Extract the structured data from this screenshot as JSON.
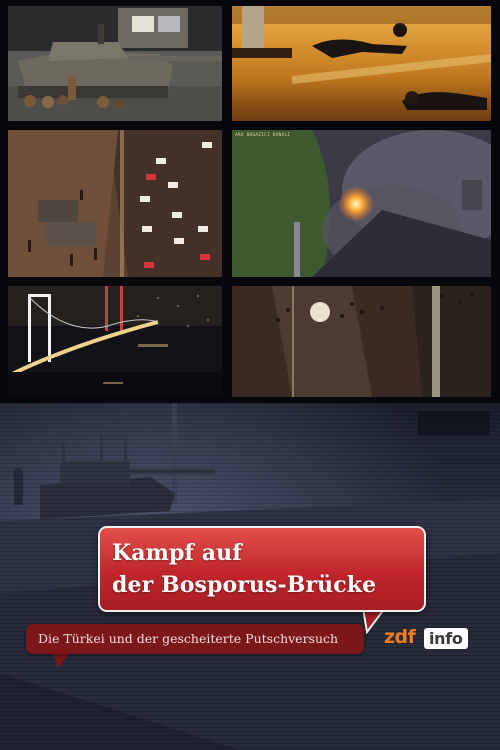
{
  "poster": {
    "title_line_1": "Kampf auf",
    "title_line_2": "der Bosporus-Brücke",
    "subtitle": "Die Türkei und der gescheiterte Putschversuch",
    "logo_prefix": "zdf",
    "logo_suffix": "info",
    "colors": {
      "title_bubble": "#c0262b",
      "subtitle_bubble": "#7b1619",
      "logo_orange": "#f07c1f"
    }
  },
  "collage": {
    "tiles": [
      {
        "name": "tank-on-street-still"
      },
      {
        "name": "people-lying-on-road-still"
      },
      {
        "name": "night-traffic-aerial-still"
      },
      {
        "name": "fire-and-smoke-aerial-still",
        "corner_text": "ARA BOGAZICI KANALI"
      },
      {
        "name": "illuminated-bridge-still"
      },
      {
        "name": "crowd-on-bridge-aerial-still"
      }
    ]
  }
}
